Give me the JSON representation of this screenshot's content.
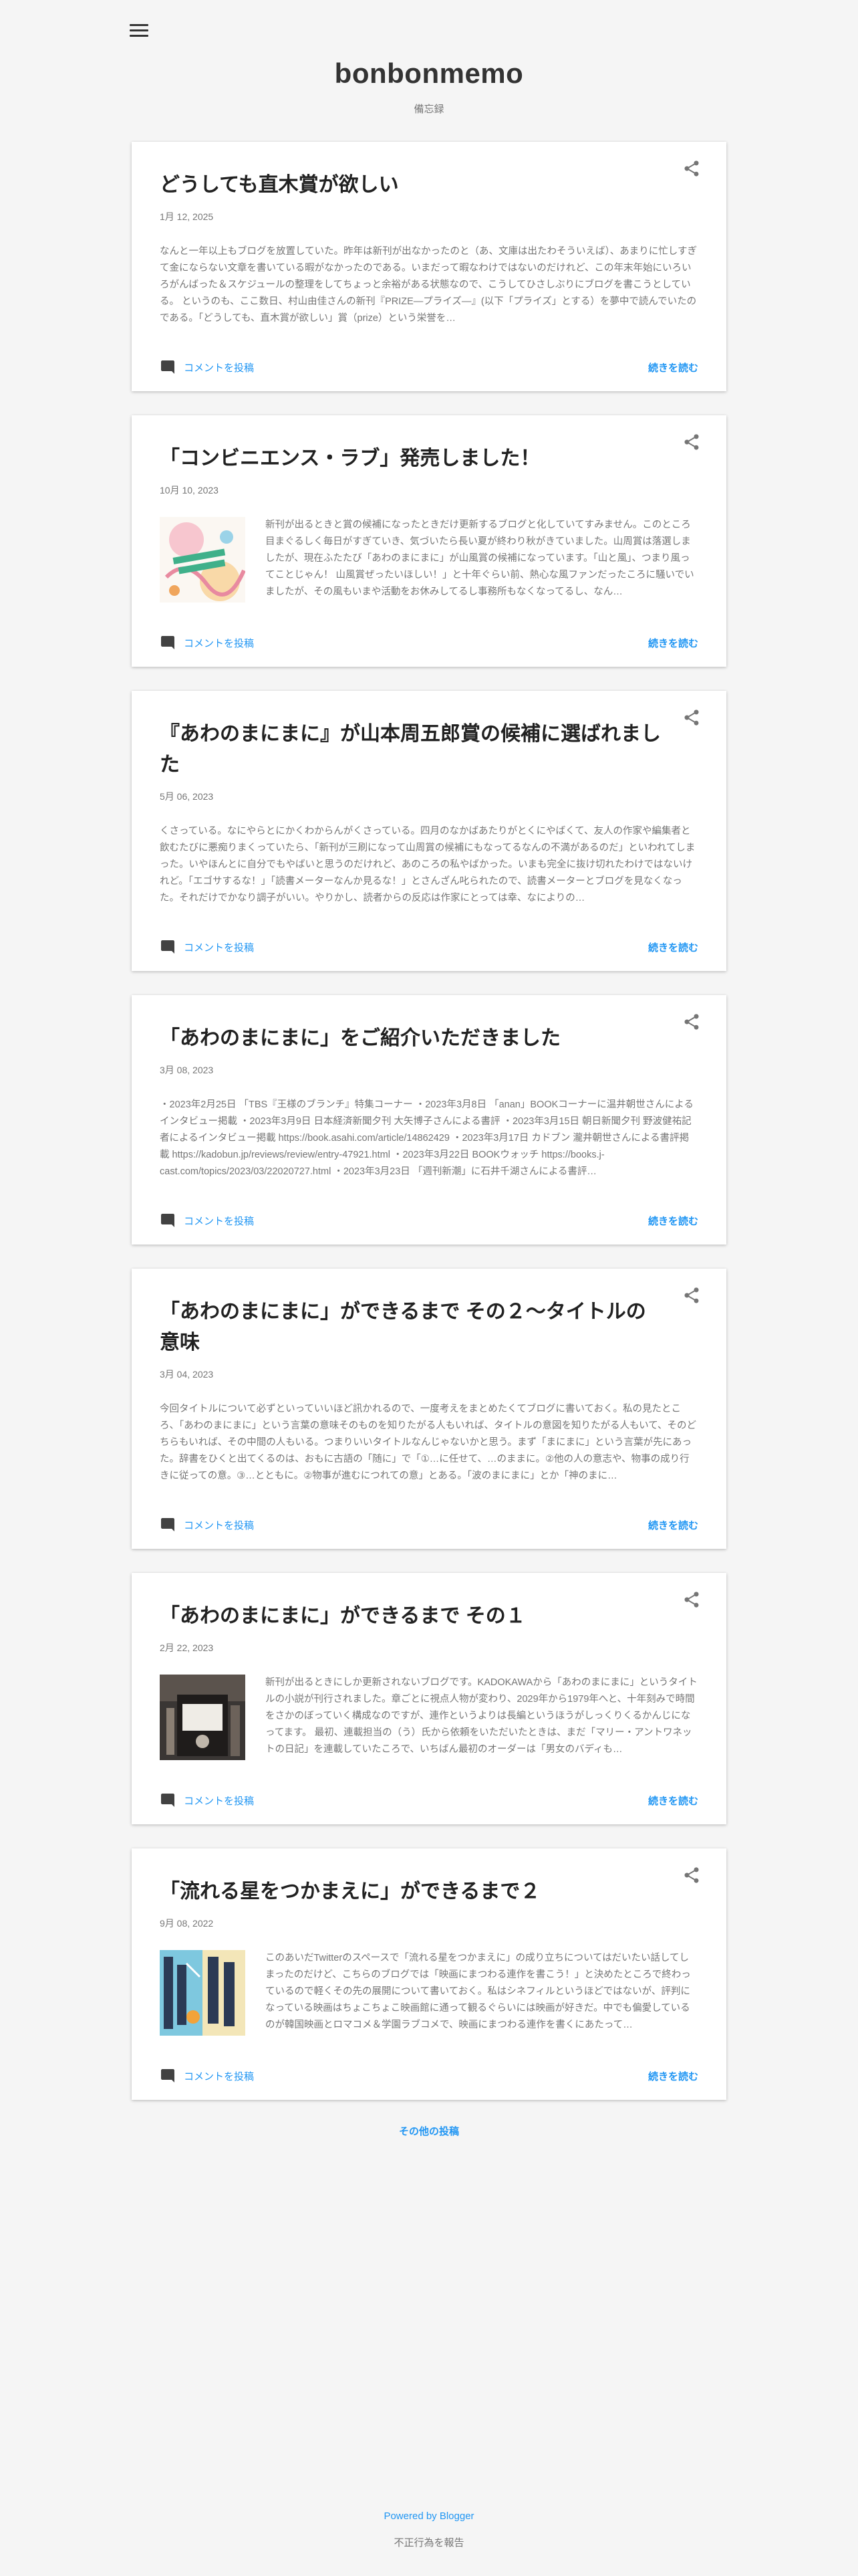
{
  "blog": {
    "title": "bonbonmemo",
    "description": "備忘録"
  },
  "colors": {
    "accent": "#2196f3",
    "background": "#f5f5f5",
    "card": "#ffffff",
    "text": "#212121",
    "muted": "#757575"
  },
  "icons": {
    "menu": "hamburger-menu-icon",
    "share": "share-icon",
    "comment": "comment-icon"
  },
  "posts": [
    {
      "title": "どうしても直木賞が欲しい",
      "date": "1月 12, 2025",
      "has_thumb": false,
      "snippet": "なんと一年以上もブログを放置していた。昨年は新刊が出なかったのと（あ、文庫は出たわそういえば）、あまりに忙しすぎて金にならない文章を書いている暇がなかったのである。いまだって暇なわけではないのだけれど、この年末年始にいろいろがんばった＆スケジュールの整理をしてちょっと余裕がある状態なので、こうしてひさしぶりにブログを書こうとしている。 というのも、ここ数日、村山由佳さんの新刊『PRIZE―プライズ―』(以下「プライズ」とする）を夢中で読んでいたのである。「どうしても、直木賞が欲しい」賞（prize）という栄誉を…",
      "comment_label": "コメントを投稿",
      "read_more": "続きを読む"
    },
    {
      "title": "「コンビニエンス・ラブ」発売しました！",
      "date": "10月 10, 2023",
      "has_thumb": true,
      "thumb": "convenience-love-cover",
      "snippet": "新刊が出るときと賞の候補になったときだけ更新するブログと化していてすみません。このところ目まぐるしく毎日がすぎていき、気づいたら長い夏が終わり秋がきていました。山周賞は落選しましたが、現在ふたたび「あわのまにまに」が山風賞の候補になっています。「山と風」、つまり風ってことじゃん！ 山風賞ぜったいほしい！」と十年ぐらい前、熱心な風ファンだったころに騒いでいましたが、その風もいまや活動をお休みしてるし事務所もなくなってるし、なん…",
      "comment_label": "コメントを投稿",
      "read_more": "続きを読む"
    },
    {
      "title": "『あわのまにまに』が山本周五郎賞の候補に選ばれました",
      "date": "5月 06, 2023",
      "has_thumb": false,
      "snippet": "くさっている。なにやらとにかくわからんがくさっている。四月のなかばあたりがとくにやばくて、友人の作家や編集者と飲むたびに悪痴りまくっていたら、「新刊が三刷になって山周賞の候補にもなってるなんの不満があるのだ」といわれてしまった。いやほんとに自分でもやばいと思うのだけれど、あのころの私やばかった。いまも完全に抜け切れたわけではないけれど。「エゴサするな！」「読書メーターなんか見るな！」とさんざん叱られたので、読書メーターとブログを見なくなった。それだけでかなり調子がいい。やりかし、読者からの反応は作家にとっては幸、なによりの…",
      "comment_label": "コメントを投稿",
      "read_more": "続きを読む"
    },
    {
      "title": "「あわのまにまに」をご紹介いただきました",
      "date": "3月 08, 2023",
      "has_thumb": false,
      "snippet": "・2023年2月25日 「TBS『王様のブランチ』特集コーナー ・2023年3月8日 「anan」BOOKコーナーに温井朝世さんによるインタビュー掲載 ・2023年3月9日 日本経済新聞夕刊 大矢博子さんによる書評 ・2023年3月15日 朝日新聞夕刊 野波健祐記者によるインタビュー掲載 https://book.asahi.com/article/14862429 ・2023年3月17日 カドブン 瀧井朝世さんによる書評掲載 https://kadobun.jp/reviews/review/entry-47921.html ・2023年3月22日 BOOKウォッチ https://books.j-cast.com/topics/2023/03/22020727.html ・2023年3月23日 「週刊新潮」に石井千湖さんによる書評…",
      "comment_label": "コメントを投稿",
      "read_more": "続きを読む"
    },
    {
      "title": "「あわのまにまに」ができるまで その２〜タイトルの意味",
      "date": "3月 04, 2023",
      "has_thumb": false,
      "snippet": "今回タイトルについて必ずといっていいほど訊かれるので、一度考えをまとめたくてブログに書いておく。私の見たところ、「あわのまにまに」という言葉の意味そのものを知りたがる人もいれば、タイトルの意図を知りたがる人もいて、そのどちらもいれば、その中間の人もいる。つまりいいタイトルなんじゃないかと思う。まず「まにまに」という言葉が先にあった。辞書をひくと出てくるのは、おもに古語の「随に」で「①…に任せて、…のままに。②他の人の意志や、物事の成り行きに従っての意。③…とともに。②物事が進むにつれての意」とある。「波のまにまに」とか「神のまに…",
      "comment_label": "コメントを投稿",
      "read_more": "続きを読む"
    },
    {
      "title": "「あわのまにまに」ができるまで その１",
      "date": "2月 22, 2023",
      "has_thumb": true,
      "thumb": "awanomanimani-cover",
      "snippet": "新刊が出るときにしか更新されないブログです。KADOKAWAから「あわのまにまに」というタイトルの小説が刊行されました。章ごとに視点人物が変わり、2029年から1979年へと、十年刻みで時間をさかのぼっていく構成なのですが、連作というよりは長編というほうがしっくりくるかんじになってます。 最初、連載担当の（う）氏から依頼をいただいたときは、まだ「マリー・アントワネットの日記」を連載していたころで、いちばん最初のオーダーは「男女のバディも…",
      "comment_label": "コメントを投稿",
      "read_more": "続きを読む"
    },
    {
      "title": "「流れる星をつかまえに」ができるまで２",
      "date": "9月 08, 2022",
      "has_thumb": true,
      "thumb": "nagareru-hoshi-cover",
      "snippet": "このあいだTwitterのスペースで「流れる星をつかまえに」の成り立ちについてはだいたい話してしまったのだけど、こちらのブログでは「映画にまつわる連作を書こう！」と決めたところで終わっているので軽くその先の展開について書いておく。私はシネフィルというほどではないが、評判になっている映画はちょこちょこ映画館に通って観るぐらいには映画が好きだ。中でも偏愛しているのが韓国映画とロマコメ＆学園ラブコメで、映画にまつわる連作を書くにあたって…",
      "comment_label": "コメントを投稿",
      "read_more": "続きを読む"
    }
  ],
  "more_posts": "その他の投稿",
  "footer": {
    "powered_by": "Powered by Blogger",
    "report_abuse": "不正行為を報告"
  }
}
